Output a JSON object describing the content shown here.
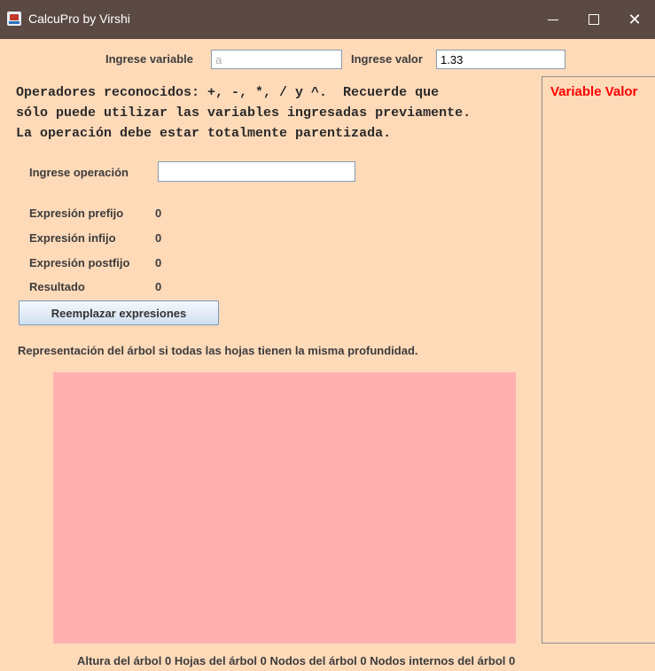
{
  "window": {
    "title": "CalcuPro by Virshi",
    "min_glyph": "—",
    "max_glyph": "",
    "close_glyph": "✕"
  },
  "variable_input": {
    "label": "Ingrese variable",
    "value": "",
    "placeholder": "a"
  },
  "value_input": {
    "label": "Ingrese valor",
    "value": "1.33"
  },
  "instructions": "Operadores reconocidos: +, -, *, / y ^.  Recuerde que\nsólo puede utilizar las variables ingresadas previamente.\nLa operación debe estar totalmente parentizada.",
  "operation_input": {
    "label": "Ingrese operación",
    "value": ""
  },
  "results": {
    "prefix_label": "Expresión prefijo",
    "prefix_value": "0",
    "infix_label": "Expresión infijo",
    "infix_value": "0",
    "postfix_label": "Expresión postfijo",
    "postfix_value": "0",
    "result_label": "Resultado",
    "result_value": "0"
  },
  "replace_button": "Reemplazar expresiones",
  "tree_caption": "Representación del árbol si todas las hojas tienen  la misma profundidad.",
  "variables_panel": {
    "header": "Variable Valor"
  },
  "footer": {
    "height_label": "Altura del árbol",
    "height_value": "0",
    "leaves_label": "Hojas del árbol",
    "leaves_value": "0",
    "nodes_label": "Nodos del árbol",
    "nodes_value": "0",
    "internal_label": "Nodos internos del árbol",
    "internal_value": "0"
  },
  "colors": {
    "background": "#ffdab9",
    "tree_panel": "#ffb1b1",
    "header_red": "#ff0000",
    "titlebar": "#5b4a44"
  }
}
